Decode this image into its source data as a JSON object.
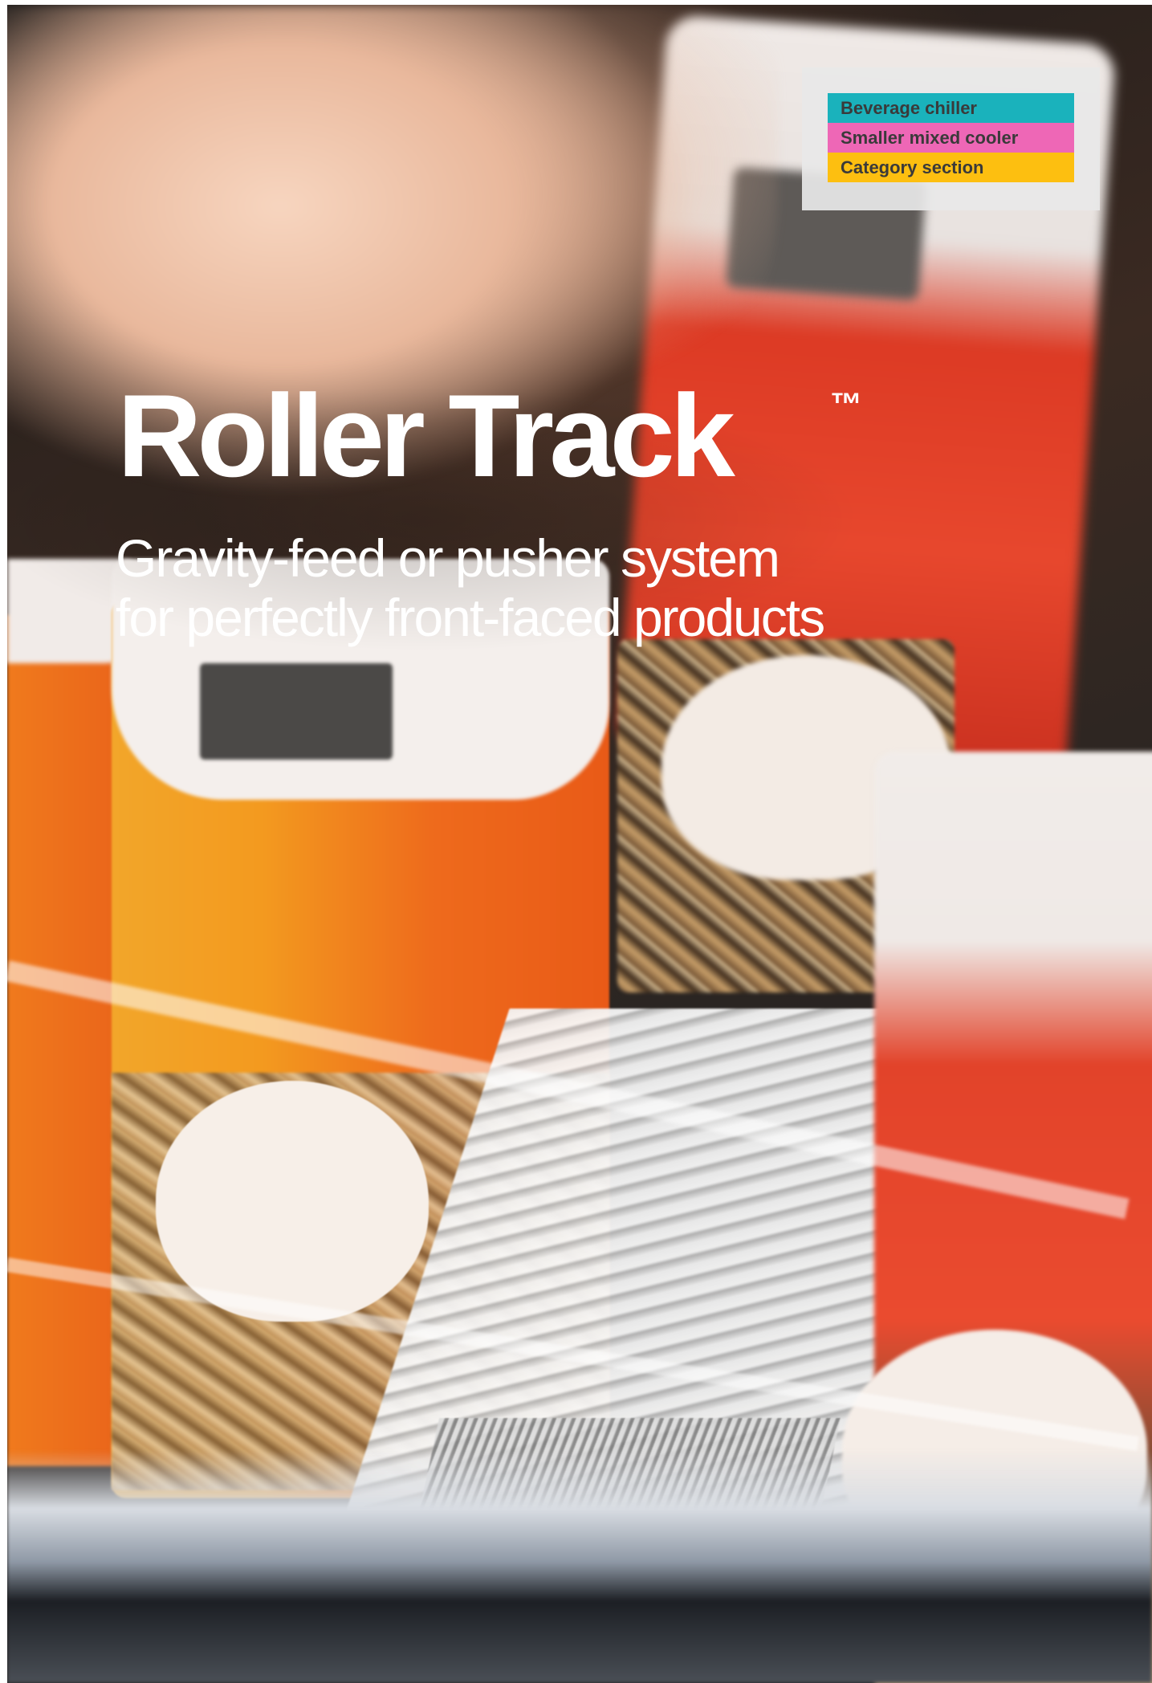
{
  "legend": {
    "items": [
      {
        "label": "Beverage chiller",
        "color": "#1ab2bc"
      },
      {
        "label": "Smaller mixed cooler",
        "color": "#ee67b6"
      },
      {
        "label": "Category section",
        "color": "#fdbf10"
      }
    ]
  },
  "headline": {
    "title": "Roller Track",
    "trademark": "™",
    "subtitle_line_1": "Gravity-feed or pusher system",
    "subtitle_line_2": "for perfectly front-faced products"
  }
}
